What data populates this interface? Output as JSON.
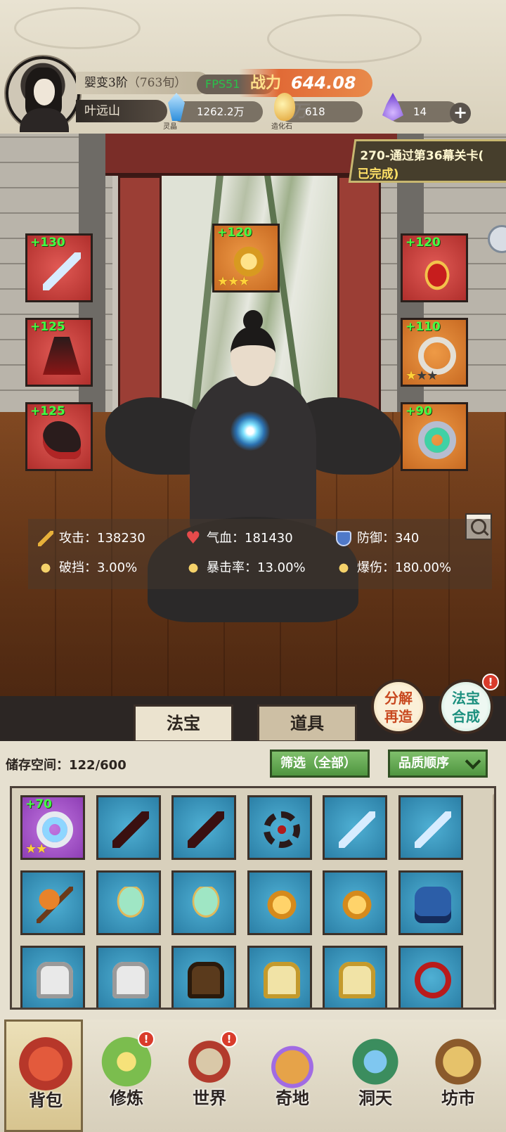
{
  "header": {
    "realm": "婴变3阶",
    "realm_age": "（763旬）",
    "hero_name": "叶远山",
    "fps": "FPS51",
    "power_label": "战力",
    "power_value": "644.08万"
  },
  "resources": [
    {
      "icon": "spirit-crystal-icon",
      "label": "灵晶",
      "value": "1262.2万"
    },
    {
      "icon": "creation-stone-icon",
      "label": "造化石",
      "value": "618"
    },
    {
      "icon": "purple-flame-icon",
      "label": "",
      "value": "14"
    }
  ],
  "quest": {
    "line1": "270-通过第36幕关卡(",
    "line2": "已完成)"
  },
  "equipment": {
    "left": [
      {
        "level": "+130",
        "item": "ice-sword",
        "quality": "red"
      },
      {
        "level": "+125",
        "item": "crimson-robe",
        "quality": "red"
      },
      {
        "level": "+125",
        "item": "shadow-boots",
        "quality": "red"
      }
    ],
    "center": {
      "level": "+120",
      "item": "golden-talisman",
      "quality": "orange",
      "stars": 3,
      "max_stars": 3
    },
    "right": [
      {
        "level": "+120",
        "item": "flame-crown",
        "quality": "red"
      },
      {
        "level": "+110",
        "item": "jade-amulet",
        "quality": "orange",
        "stars": 1,
        "max_stars": 3
      },
      {
        "level": "+90",
        "item": "jade-ring",
        "quality": "orange"
      }
    ]
  },
  "stats": {
    "attack": "攻击：138230",
    "hp": "气血：181430",
    "defense": "防御：340",
    "break": "破挡：3.00%",
    "crit": "暴击率：13.00%",
    "crit_dmg": "爆伤：180.00%"
  },
  "actions": {
    "decompose_line1": "分解",
    "decompose_line2": "再造",
    "synth_line1": "法宝",
    "synth_line2": "合成",
    "badge": "!"
  },
  "tabs": {
    "fabao": "法宝",
    "daoju": "道具"
  },
  "inventory": {
    "storage": "储存空间：122/600",
    "filter": "筛选（全部）",
    "sort": "品质顺序",
    "items": [
      {
        "level": "+70",
        "art": "a-ring-blue",
        "quality": "purple",
        "stars": 2
      },
      {
        "level": "",
        "art": "a-dagger",
        "quality": "blue"
      },
      {
        "level": "",
        "art": "a-dagger",
        "quality": "blue"
      },
      {
        "level": "",
        "art": "a-wheel",
        "quality": "blue"
      },
      {
        "level": "",
        "art": "a-sword",
        "quality": "blue"
      },
      {
        "level": "",
        "art": "a-sword",
        "quality": "blue"
      },
      {
        "level": "",
        "art": "a-axe",
        "quality": "blue"
      },
      {
        "level": "",
        "art": "a-fan",
        "quality": "blue"
      },
      {
        "level": "",
        "art": "a-fan",
        "quality": "blue"
      },
      {
        "level": "",
        "art": "a-golden-armor",
        "quality": "blue"
      },
      {
        "level": "",
        "art": "a-golden-armor",
        "quality": "blue"
      },
      {
        "level": "",
        "art": "a-blue-robe",
        "quality": "blue"
      },
      {
        "level": "",
        "art": "a-white-robe",
        "quality": "blue"
      },
      {
        "level": "",
        "art": "a-white-robe",
        "quality": "blue"
      },
      {
        "level": "",
        "art": "a-brown-robe",
        "quality": "blue"
      },
      {
        "level": "",
        "art": "a-gold-plate",
        "quality": "blue"
      },
      {
        "level": "",
        "art": "a-gold-plate",
        "quality": "blue"
      },
      {
        "level": "",
        "art": "a-red-scarf",
        "quality": "blue"
      }
    ]
  },
  "nav": [
    {
      "label": "背包",
      "icon": "bag-icon",
      "active": true,
      "alert": false
    },
    {
      "label": "修炼",
      "icon": "cultivate-icon",
      "active": false,
      "alert": true
    },
    {
      "label": "世界",
      "icon": "world-scroll-icon",
      "active": false,
      "alert": true
    },
    {
      "label": "奇地",
      "icon": "wonderland-icon",
      "active": false,
      "alert": false
    },
    {
      "label": "洞天",
      "icon": "cave-heaven-icon",
      "active": false,
      "alert": false
    },
    {
      "label": "坊市",
      "icon": "market-icon",
      "active": false,
      "alert": false
    }
  ],
  "colors": {
    "power_bg": "#e16a36",
    "level_green": "#44ff44",
    "alert_red": "#d93b2b",
    "filter_green": "#5fa64c"
  }
}
